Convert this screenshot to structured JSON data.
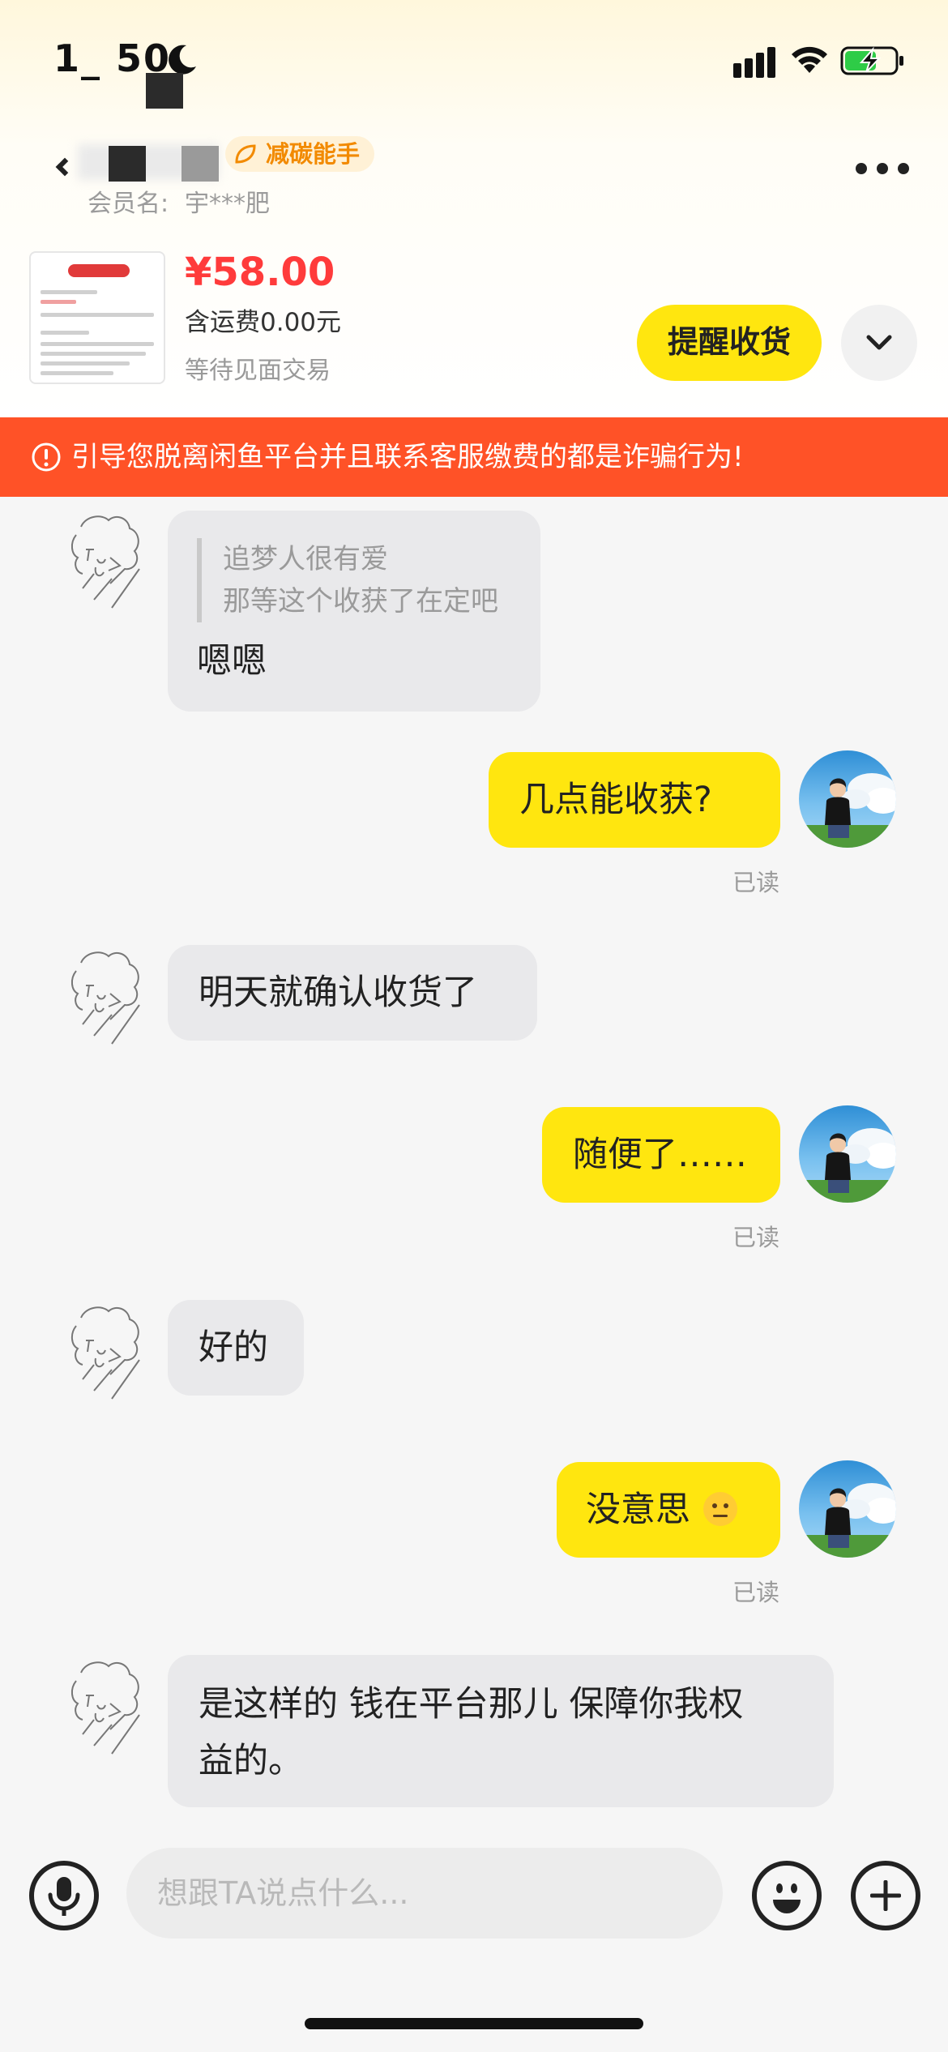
{
  "status_bar": {
    "time": "1_ 50",
    "icons": [
      "moon-icon",
      "signal-icon",
      "wifi-icon",
      "battery-charging-icon"
    ]
  },
  "header": {
    "badge_label": "减碳能手",
    "member_label": "会员名:",
    "member_name": "宇***肥",
    "icons": [
      "back-icon",
      "more-icon"
    ]
  },
  "order": {
    "price": "¥58.00",
    "shipping": "含运费0.00元",
    "status": "等待见面交易",
    "remind_button": "提醒收货",
    "icons": [
      "chevron-down-icon"
    ]
  },
  "warning": {
    "text": "引导您脱离闲鱼平台并且联系客服缴费的都是诈骗行为!",
    "icon": "alert-circle-icon"
  },
  "messages": [
    {
      "side": "left",
      "quote_line1": "追梦人很有爱",
      "quote_line2": "那等这个收获了在定吧",
      "text": "嗯嗯"
    },
    {
      "side": "right",
      "text": "几点能收获?",
      "status": "已读"
    },
    {
      "side": "left",
      "text": "明天就确认收货了"
    },
    {
      "side": "right",
      "text": "随便了……",
      "status": "已读"
    },
    {
      "side": "left",
      "text": "好的"
    },
    {
      "side": "right",
      "text": "没意思",
      "emoji": "neutral-face-emoji",
      "status": "已读"
    },
    {
      "side": "left",
      "text_line1": "是这样的 钱在平台那儿 保障你我权",
      "text_line2": "益的。"
    }
  ],
  "input_bar": {
    "placeholder": "想跟TA说点什么...",
    "icons": [
      "microphone-icon",
      "emoji-icon",
      "plus-icon"
    ]
  },
  "colors": {
    "accent_yellow": "#ffe60f",
    "warning_orange": "#ff5227",
    "price_red": "#ff3b3b",
    "badge_orange": "#f28a00"
  }
}
